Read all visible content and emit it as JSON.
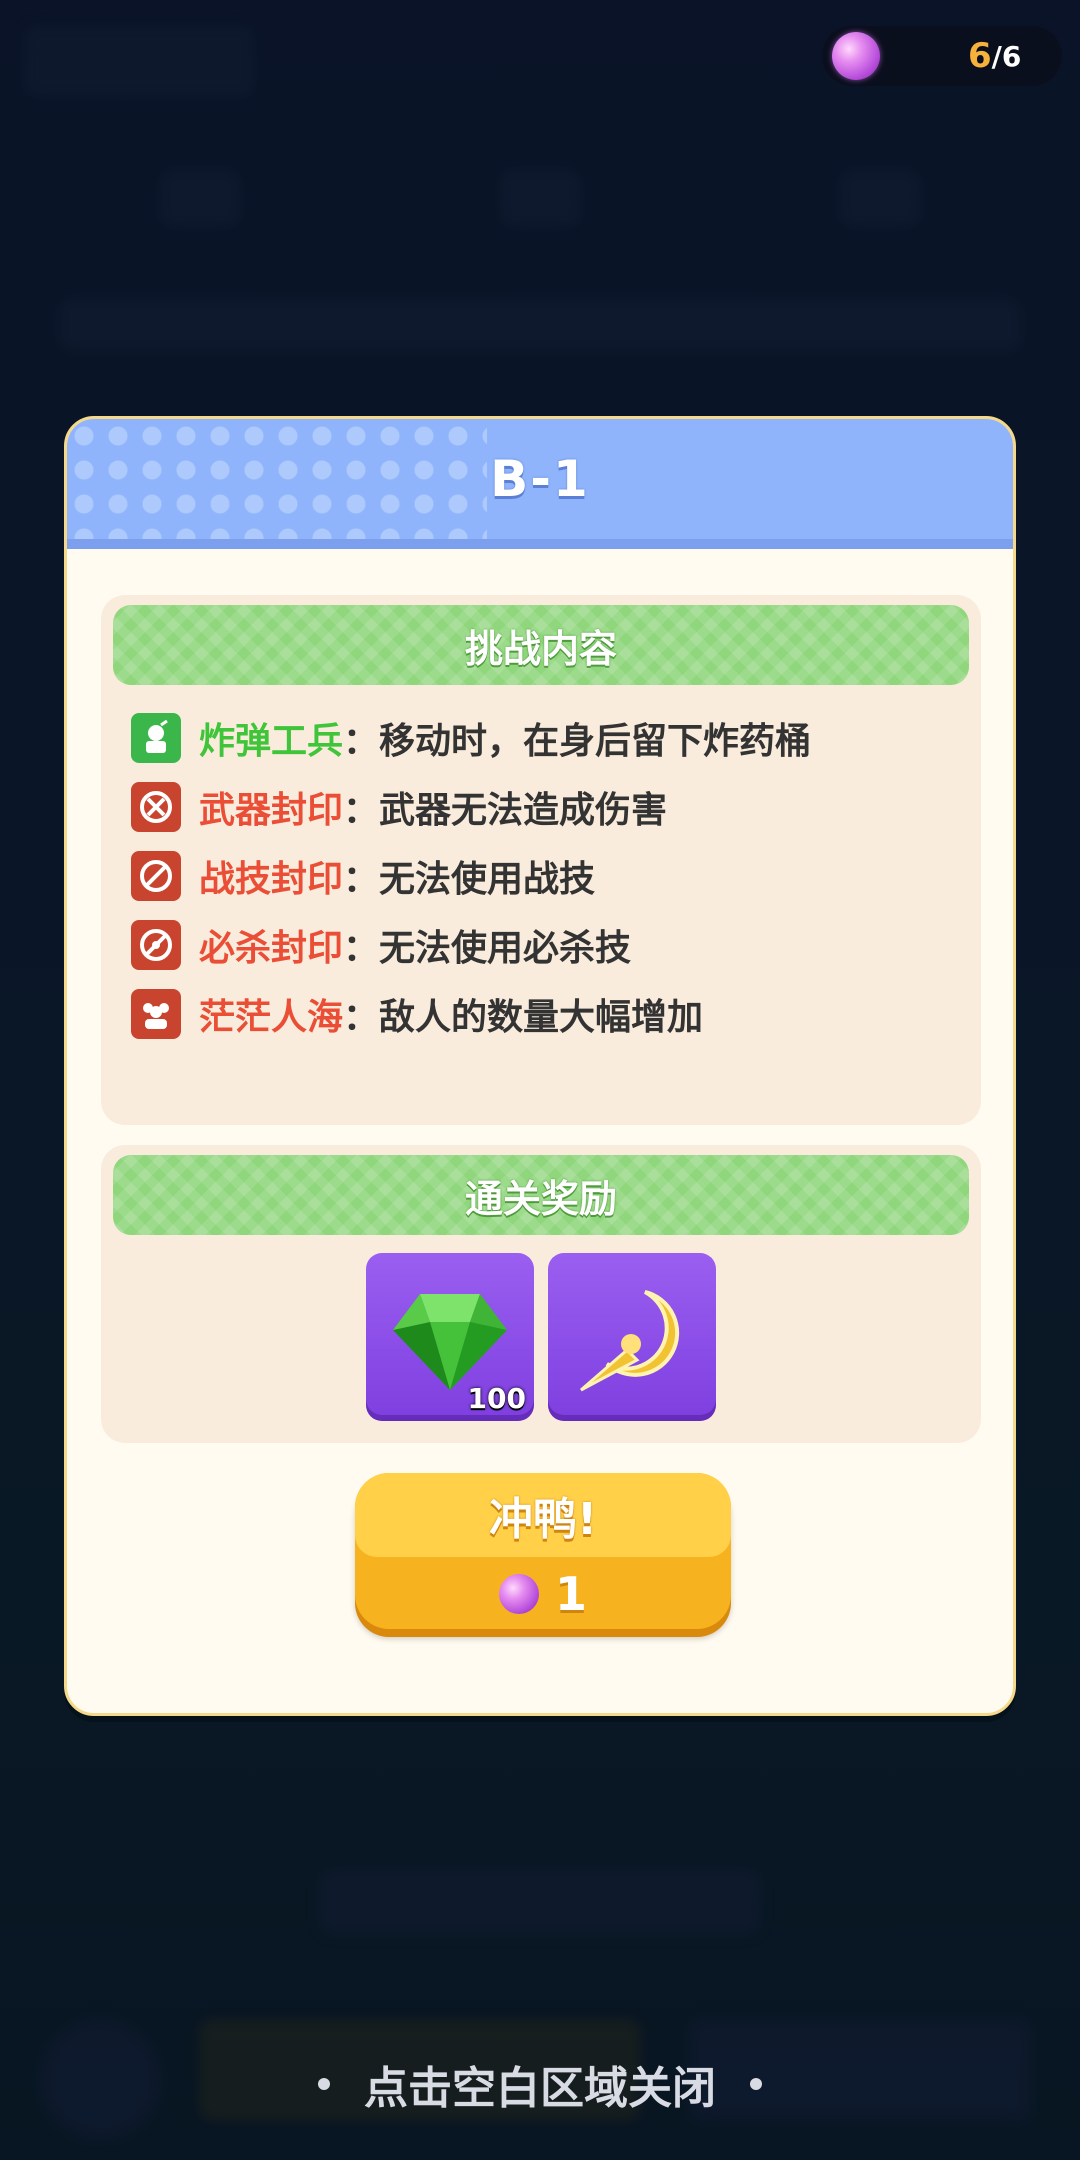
{
  "energy": {
    "current": "6",
    "total": "/6",
    "icon": "energy-orb-icon"
  },
  "dialog": {
    "title": "B-1",
    "challenge": {
      "heading": "挑战内容",
      "separator": "：",
      "items": [
        {
          "name": "炸弹工兵",
          "desc": "移动时，在身后留下炸药桶",
          "color": "green",
          "icon": "bomb-engineer-icon"
        },
        {
          "name": "武器封印",
          "desc": "武器无法造成伤害",
          "color": "red",
          "icon": "weapon-seal-icon"
        },
        {
          "name": "战技封印",
          "desc": "无法使用战技",
          "color": "red",
          "icon": "skill-seal-icon"
        },
        {
          "name": "必杀封印",
          "desc": "无法使用必杀技",
          "color": "red",
          "icon": "ultimate-seal-icon"
        },
        {
          "name": "茫茫人海",
          "desc": "敌人的数量大幅增加",
          "color": "red",
          "icon": "crowd-icon"
        }
      ]
    },
    "rewards": {
      "heading": "通关奖励",
      "items": [
        {
          "icon": "green-gem-icon",
          "qty": "100"
        },
        {
          "icon": "golden-crescent-icon",
          "qty": ""
        }
      ]
    },
    "go_button": {
      "label": "冲鸭!",
      "cost": "1"
    }
  },
  "close_hint": "点击空白区域关闭",
  "colors": {
    "green_text": "#3fc43a",
    "red_text": "#ea4e36",
    "header_blue": "#8fb4fb",
    "button_yellow": "#f6b21f"
  }
}
